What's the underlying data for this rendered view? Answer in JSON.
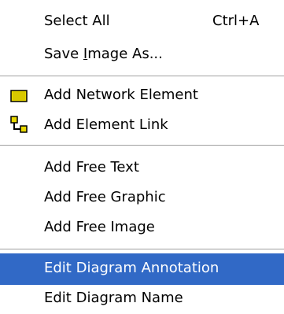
{
  "menu": {
    "items": [
      {
        "label": "Select All",
        "shortcut": "Ctrl+A"
      },
      {
        "label_pre": "Save ",
        "label_u": "I",
        "label_post": "mage As..."
      },
      {
        "label": "Add Network Element",
        "icon": "network-element-icon",
        "icon_color": "#e8d800"
      },
      {
        "label": "Add Element Link",
        "icon": "element-link-icon",
        "icon_color": "#e8d800"
      },
      {
        "label": "Add Free Text"
      },
      {
        "label": "Add Free Graphic"
      },
      {
        "label": "Add Free Image"
      },
      {
        "label": "Edit Diagram Annotation",
        "highlighted": true
      },
      {
        "label": "Edit Diagram Name"
      }
    ]
  },
  "colors": {
    "highlight_bg": "#3169c6",
    "highlight_text": "#ffffff",
    "separator": "#a0a0a0"
  }
}
